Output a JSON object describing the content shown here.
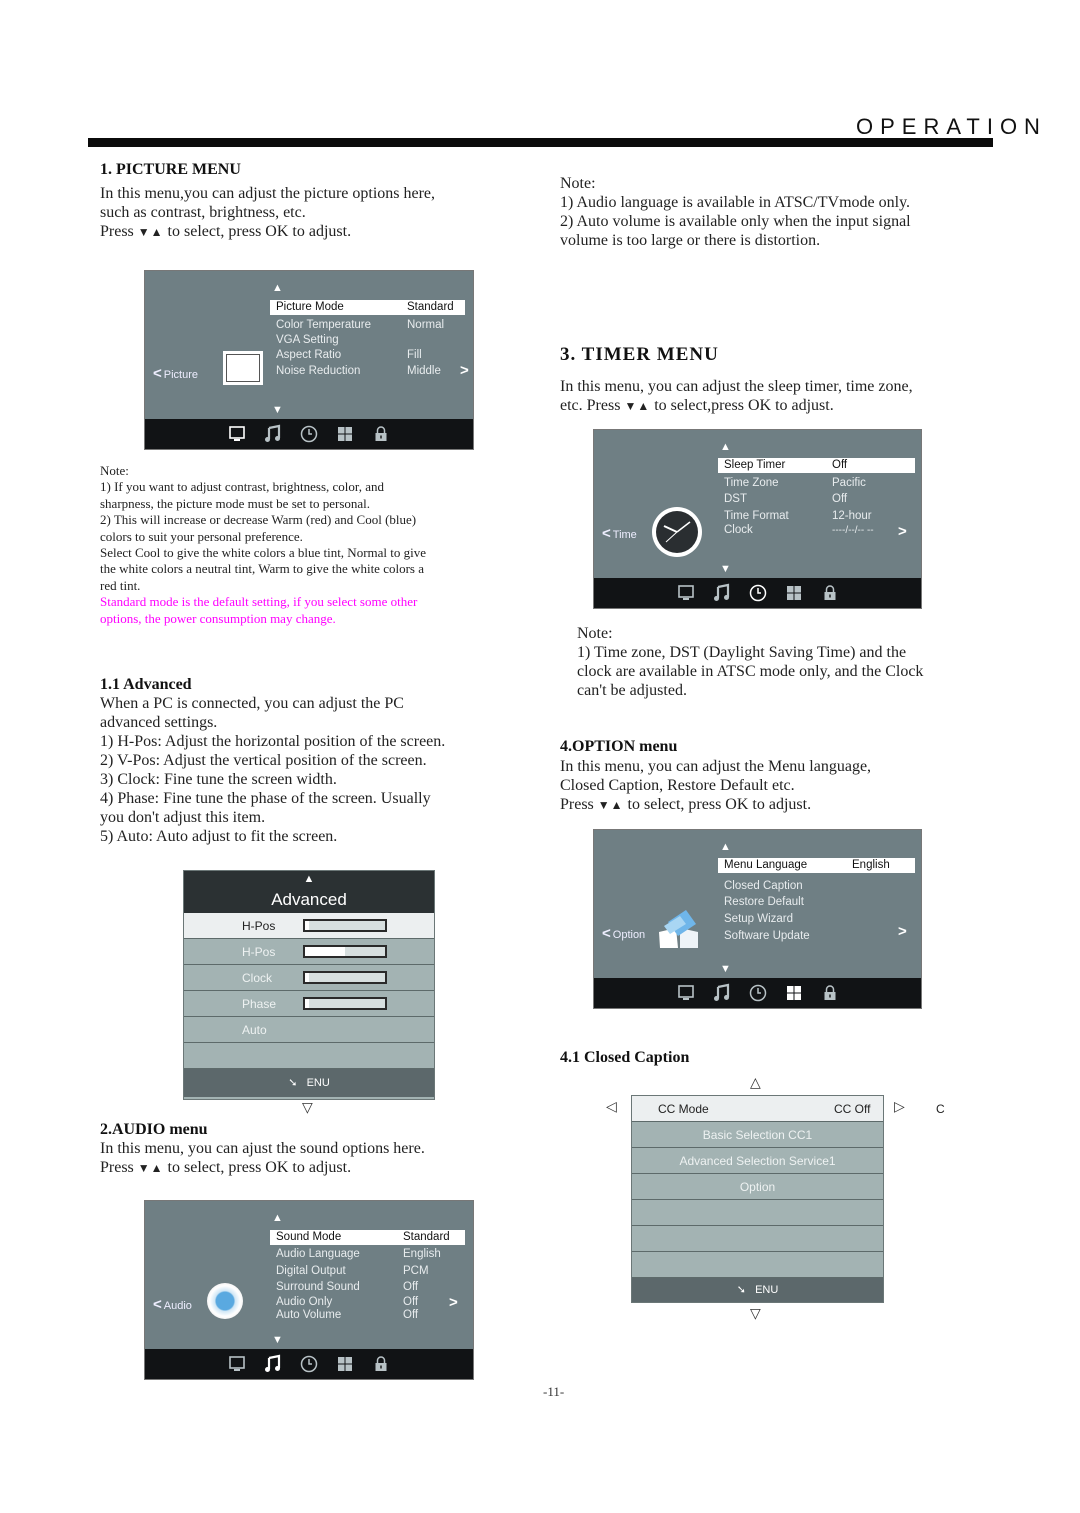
{
  "header": {
    "title": "OPERATION"
  },
  "left": {
    "picture": {
      "heading": "1. PICTURE MENU",
      "lines": [
        "In this menu,you can adjust the picture options here,",
        "such as contrast, brightness, etc."
      ],
      "press_prefix": "Press",
      "press_arrows": "▼▲",
      "press_suffix": "to select, press OK to adjust.",
      "osd": {
        "side_label": "Picture",
        "items": [
          {
            "label": "Picture Mode",
            "value": "Standard"
          },
          {
            "label": "Color Temperature",
            "value": "Normal"
          },
          {
            "label": "VGA Setting",
            "value": ""
          },
          {
            "label": "Aspect Ratio",
            "value": "Fill"
          },
          {
            "label": "Noise Reduction",
            "value": "Middle"
          }
        ],
        "active_tab": "picture"
      },
      "note_title": "Note:",
      "notes": [
        "1) If you want to adjust contrast, brightness, color, and",
        "sharpness, the picture mode must be set to personal.",
        "2) This will increase or decrease Warm (red) and Cool (blue)",
        "colors to suit your personal preference.",
        "Select Cool to give the white colors a blue tint, Normal to give",
        "the white colors a neutral tint, Warm to give the white colors a",
        "red tint."
      ],
      "warning": [
        "Standard mode is the default setting, if you select some other",
        "options, the power consumption may change."
      ],
      "warning_color": "#ff00ff"
    },
    "advanced": {
      "heading": "1.1 Advanced",
      "lines": [
        "When a PC is connected, you can adjust the PC",
        "advanced settings.",
        "1) H-Pos: Adjust the horizontal position of the screen.",
        "2) V-Pos: Adjust the vertical position of the screen.",
        "3) Clock: Fine tune the screen width.",
        "4) Phase: Fine tune the phase of the screen. Usually",
        "you don't adjust this item.",
        "5) Auto: Auto adjust to fit the screen."
      ],
      "menu": {
        "title": "Advanced",
        "items": [
          {
            "label": "H-Pos",
            "level": 0.05
          },
          {
            "label": "H-Pos",
            "level": 0.5
          },
          {
            "label": "Clock",
            "level": 0.05
          },
          {
            "label": "Phase",
            "level": 0.05
          },
          {
            "label": "Auto",
            "level": null
          },
          {
            "label": "",
            "level": null
          }
        ],
        "footer": "ENU"
      }
    },
    "audio": {
      "heading": "2.AUDIO menu",
      "line": "In this menu, you can ajust the sound options here.",
      "press_prefix": "Press",
      "press_arrows": "▼▲",
      "press_suffix": "to select, press OK to adjust.",
      "osd": {
        "side_label": "Audio",
        "items": [
          {
            "label": "Sound Mode",
            "value": "Standard"
          },
          {
            "label": "Audio Language",
            "value": "English"
          },
          {
            "label": "Digital Output",
            "value": "PCM"
          },
          {
            "label": "Surround Sound",
            "value": "Off"
          },
          {
            "label": "Audio Only",
            "value": "Off"
          },
          {
            "label": "Auto Volume",
            "value": "Off"
          }
        ],
        "active_tab": "audio"
      }
    }
  },
  "right": {
    "audio_note": {
      "title": "Note:",
      "lines": [
        "1) Audio language is available in ATSC/TVmode only.",
        "2) Auto volume is available only when the input signal",
        "volume is too large or there is distortion."
      ]
    },
    "timer": {
      "heading": "3. TIMER MENU",
      "lines": [
        "In this menu, you can adjust the sleep timer, time zone,"
      ],
      "press_prefix": "etc. Press",
      "press_arrows": "▼▲",
      "press_suffix": "to select,press OK to adjust.",
      "osd": {
        "side_label": "Time",
        "items": [
          {
            "label": "Sleep Timer",
            "value": "Off"
          },
          {
            "label": "Time Zone",
            "value": "Pacific"
          },
          {
            "label": "DST",
            "value": "Off"
          },
          {
            "label": "Time Format",
            "value": "12-hour"
          },
          {
            "label": "Clock",
            "value": "----/--/-- --"
          }
        ],
        "active_tab": "timer"
      },
      "note_title": "Note:",
      "notes": [
        "1) Time zone, DST (Daylight Saving Time) and the",
        "clock are available in ATSC mode only, and the Clock",
        "can't be adjusted."
      ]
    },
    "option": {
      "heading": "4.OPTION menu",
      "lines": [
        "In this menu, you can adjust the Menu language,",
        "Closed Caption, Restore Default etc."
      ],
      "press_prefix": "Press",
      "press_arrows": "▼▲",
      "press_suffix": "to select, press OK to adjust.",
      "osd": {
        "side_label": "Option",
        "items": [
          {
            "label": "Menu Language",
            "value": "English"
          },
          {
            "label": "Closed Caption",
            "value": ""
          },
          {
            "label": "Restore Default",
            "value": ""
          },
          {
            "label": "Setup Wizard",
            "value": ""
          },
          {
            "label": "Software Update",
            "value": ""
          }
        ],
        "active_tab": "option"
      }
    },
    "cc": {
      "heading": "4.1 Closed Caption",
      "menu": {
        "items": [
          {
            "label": "CC Mode",
            "value": "CC Off"
          },
          {
            "label": "Basic Selection CC1",
            "value": ""
          },
          {
            "label": "Advanced Selection Service1",
            "value": ""
          },
          {
            "label": "Option",
            "value": ""
          },
          {
            "label": "",
            "value": ""
          },
          {
            "label": "",
            "value": ""
          },
          {
            "label": "",
            "value": ""
          }
        ],
        "footer": "ENU",
        "right_extra": "C"
      }
    }
  },
  "footer": {
    "page_number": "-11-"
  }
}
